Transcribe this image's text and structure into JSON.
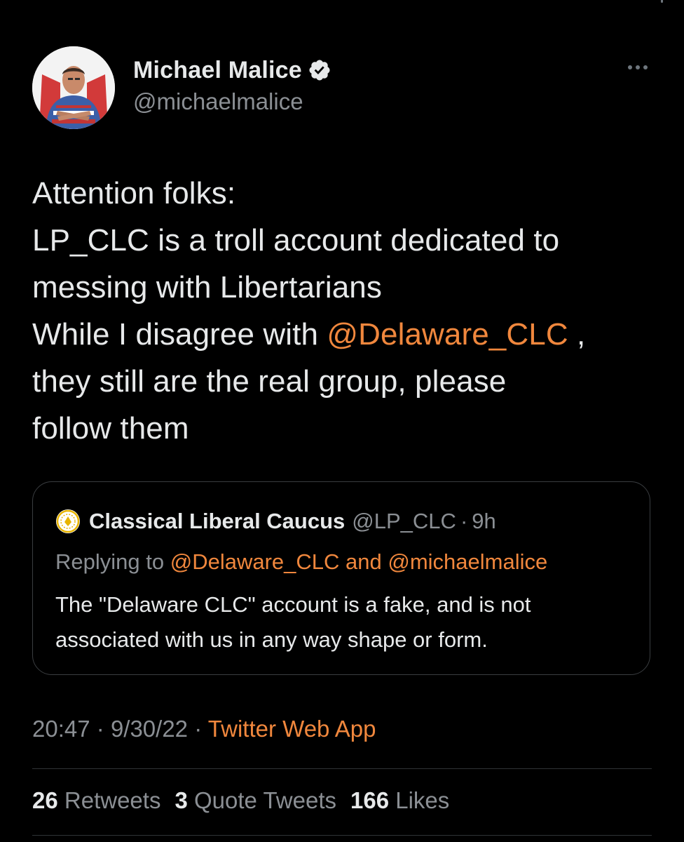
{
  "tweet": {
    "author": {
      "display_name": "Michael Malice",
      "handle": "@michaelmalice",
      "avatar_icon": "avatar-image",
      "verified_icon": "verified-badge-icon"
    },
    "more_icon": "more-options-icon",
    "text_lines": {
      "l1": "Attention folks:",
      "l2": "LP_CLC is a troll account dedicated to",
      "l3": "messing with Libertarians",
      "l4_before": "While I disagree with ",
      "l4_mention": "@Delaware_CLC",
      "l4_after": " ,",
      "l5": "they still are the real group, please",
      "l6": "follow them"
    },
    "quote": {
      "display_name": "Classical Liberal Caucus",
      "handle": "@LP_CLC",
      "separator": "·",
      "time": "9h",
      "reply_prefix": "Replying to ",
      "reply_mention_1": "@Delaware_CLC",
      "reply_and": " and ",
      "reply_mention_2": "@michaelmalice",
      "body_line_1": "The \"Delaware CLC\" account is a fake, and is not",
      "body_line_2": "associated with us in any way shape or form."
    },
    "meta": {
      "time": "20:47",
      "separator": "·",
      "date": "9/30/22",
      "source": "Twitter Web App"
    },
    "stats": {
      "retweets_count": "26",
      "retweets_label": "Retweets",
      "quotes_count": "3",
      "quotes_label": "Quote Tweets",
      "likes_count": "166",
      "likes_label": "Likes"
    }
  },
  "colors": {
    "background": "#000000",
    "text": "#e7e9ea",
    "secondary": "#8b8f94",
    "accent": "#f0873d",
    "border": "#3a3d40"
  }
}
